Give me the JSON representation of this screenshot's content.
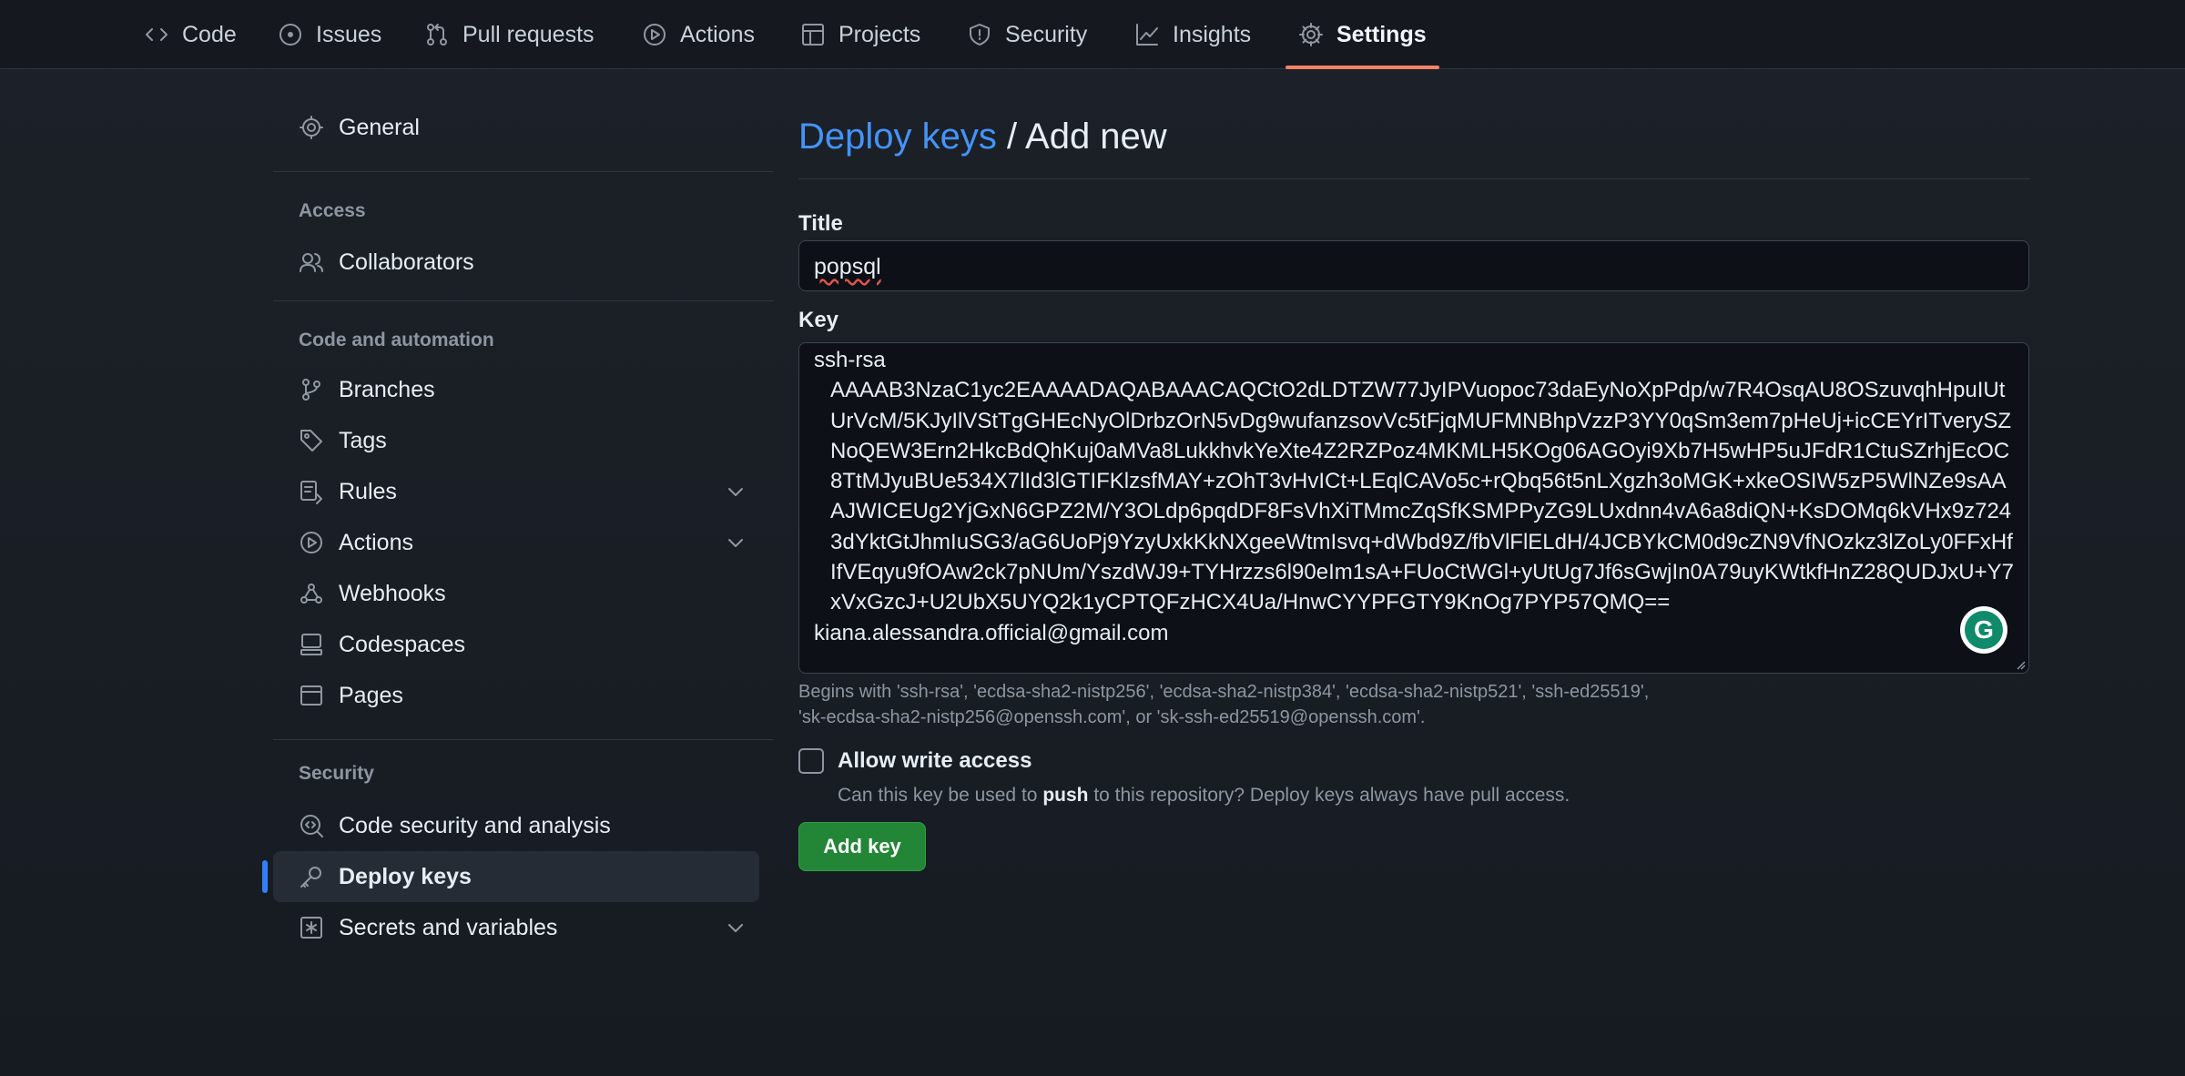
{
  "repo_nav": {
    "tabs": [
      {
        "label": "Code",
        "icon": "code-icon"
      },
      {
        "label": "Issues",
        "icon": "issue-icon"
      },
      {
        "label": "Pull requests",
        "icon": "pull-request-icon"
      },
      {
        "label": "Actions",
        "icon": "play-icon"
      },
      {
        "label": "Projects",
        "icon": "table-icon"
      },
      {
        "label": "Security",
        "icon": "shield-icon"
      },
      {
        "label": "Insights",
        "icon": "graph-icon"
      },
      {
        "label": "Settings",
        "icon": "gear-icon",
        "active": true
      }
    ]
  },
  "sidebar": {
    "general": "General",
    "access_heading": "Access",
    "collaborators": "Collaborators",
    "code_heading": "Code and automation",
    "branches": "Branches",
    "tags": "Tags",
    "rules": "Rules",
    "actions": "Actions",
    "webhooks": "Webhooks",
    "codespaces": "Codespaces",
    "pages": "Pages",
    "security_heading": "Security",
    "code_security": "Code security and analysis",
    "deploy_keys": "Deploy keys",
    "secrets": "Secrets and variables"
  },
  "page": {
    "breadcrumb_link": "Deploy keys",
    "breadcrumb_sep": " / ",
    "breadcrumb_current": "Add new"
  },
  "form": {
    "title_label": "Title",
    "title_value": "popsql",
    "key_label": "Key",
    "key_type": "ssh-rsa",
    "key_body": "AAAAB3NzaC1yc2EAAAADAQABAAACAQCtO2dLDTZW77JyIPVuopoc73daEyNoXpPdp/w7R4OsqAU8OSzuvqhHpuIUtUrVcM/5KJyIlVStTgGHEcNyOlDrbzOrN5vDg9wufanzsovVc5tFjqMUFMNBhpVzzP3YY0qSm3em7pHeUj+icCEYrITverySZNoQEW3Ern2HkcBdQhKuj0aMVa8LukkhvkYeXte4Z2RZPoz4MKMLH5KOg06AGOyi9Xb7H5wHP5uJFdR1CtuSZrhjEcOC8TtMJyuBUe534X7lId3lGTIFKlzsfMAY+zOhT3vHvICt+LEqlCAVo5c+rQbq56t5nLXgzh3oMGK+xkeOSIW5zP5WlNZe9sAAAJWICEUg2YjGxN6GPZ2M/Y3OLdp6pqdDF8FsVhXiTMmcZqSfKSMPPyZG9LUxdnn4vA6a8diQN+KsDOMq6kVHx9z7243dYktGtJhmIuSG3/aG6UoPj9YzyUxkKkNXgeeWtmIsvq+dWbd9Z/fbVlFlELdH/4JCBYkCM0d9cZN9VfNOzkz3lZoLy0FFxHfIfVEqyu9fOAw2ck7pNUm/YszdWJ9+TYHrzzs6l90eIm1sA+FUoCtWGl+yUtUg7Jf6sGwjIn0A79uyKWtkfHnZ28QUDJxU+Y7xVxGzcJ+U2UbX5UYQ2k1yCPTQFzHCX4Ua/HnwCYYPFGTY9KnOg7PYP57QMQ==",
    "key_comment": "kiana.alessandra.official@gmail.com",
    "key_hint_1": "Begins with 'ssh-rsa', 'ecdsa-sha2-nistp256', 'ecdsa-sha2-nistp384', 'ecdsa-sha2-nistp521', 'ssh-ed25519',",
    "key_hint_2": "'sk-ecdsa-sha2-nistp256@openssh.com', or 'sk-ssh-ed25519@openssh.com'.",
    "write_access_label": "Allow write access",
    "write_access_desc_pre": "Can this key be used to ",
    "write_access_desc_bold": "push",
    "write_access_desc_post": " to this repository? Deploy keys always have pull access.",
    "submit": "Add key",
    "grammarly_badge": "G"
  },
  "colors": {
    "accent_link": "#4493f8",
    "active_tab_underline": "#f78166",
    "primary_button": "#238636",
    "selected_indicator": "#2f81f7"
  }
}
